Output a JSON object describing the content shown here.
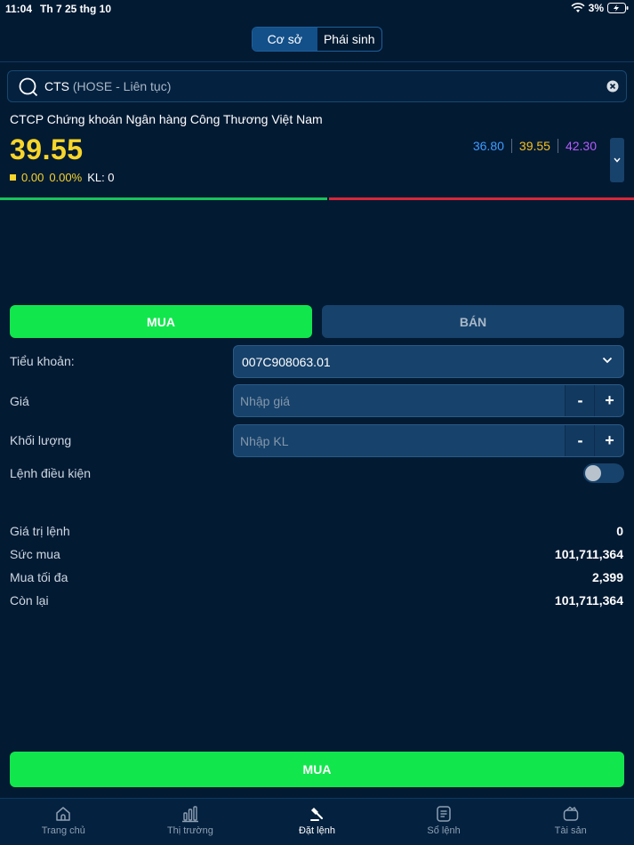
{
  "status": {
    "time": "11:04",
    "date": "Th 7 25 thg 10",
    "battery": "3%"
  },
  "header": {
    "tabs": [
      {
        "label": "Cơ sở",
        "active": true
      },
      {
        "label": "Phái sinh",
        "active": false
      }
    ]
  },
  "search": {
    "symbol": "CTS",
    "market": "(HOSE - Liên tục)"
  },
  "stock": {
    "company_name": "CTCP Chứng khoán Ngân hàng Công Thương Việt Nam",
    "price": "39.55",
    "change": "0.00",
    "change_pct": "0.00%",
    "volume_label": "KL: 0",
    "floor": "36.80",
    "reference": "39.55",
    "ceiling": "42.30"
  },
  "order": {
    "buy_tab": "MUA",
    "sell_tab": "BÁN",
    "account_label": "Tiểu khoản:",
    "account_value": "007C908063.01",
    "price_label": "Giá",
    "price_placeholder": "Nhập giá",
    "qty_label": "Khối lượng",
    "qty_placeholder": "Nhập KL",
    "minus": "-",
    "plus": "+",
    "conditional_label": "Lệnh điều kiện",
    "conditional_on": false
  },
  "summary": {
    "order_value_label": "Giá trị lệnh",
    "order_value": "0",
    "buying_power_label": "Sức mua",
    "buying_power": "101,711,364",
    "max_buy_label": "Mua tối đa",
    "max_buy": "2,399",
    "remaining_label": "Còn lại",
    "remaining": "101,711,364"
  },
  "submit_label": "MUA",
  "tabbar": [
    {
      "label": "Trang chủ",
      "icon": "home-icon"
    },
    {
      "label": "Thị trường",
      "icon": "chart-icon"
    },
    {
      "label": "Đặt lệnh",
      "icon": "gavel-icon",
      "active": true
    },
    {
      "label": "Sổ lệnh",
      "icon": "order-book-icon"
    },
    {
      "label": "Tài sản",
      "icon": "wallet-icon"
    }
  ],
  "colors": {
    "background": "#031a33",
    "buy": "#12e64d",
    "price": "#f7d52a",
    "floor": "#3d9cff",
    "ceiling": "#b45cff",
    "up_bar": "#18c35a",
    "down_bar": "#d6283a"
  }
}
